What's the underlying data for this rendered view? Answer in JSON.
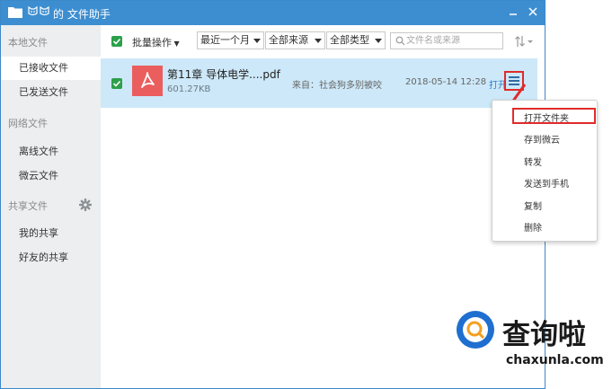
{
  "window": {
    "title": "的 文件助手"
  },
  "sidebar": {
    "section_local": "本地文件",
    "item_received": "已接收文件",
    "item_sent": "已发送文件",
    "section_network": "网络文件",
    "item_offline": "离线文件",
    "item_weiyun": "微云文件",
    "section_shared": "共享文件",
    "item_my_shares": "我的共享",
    "item_friend_shares": "好友的共享"
  },
  "toolbar": {
    "batch_label": "批量操作",
    "filter_time": "最近一个月",
    "filter_source": "全部来源",
    "filter_type": "全部类型",
    "search_placeholder": "文件名或来源"
  },
  "file": {
    "name": "第11章 导体电学....pdf",
    "size": "601.27KB",
    "from": "来自：社会狗多别被咬",
    "date": "2018-05-14 12:28",
    "open_label": "打开"
  },
  "context_menu": {
    "items": [
      "打开文件夹",
      "存到微云",
      "转发",
      "发送到手机",
      "复制",
      "删除"
    ]
  },
  "watermark": {
    "title": "查询啦",
    "domain": "chaxunla.com"
  },
  "colors": {
    "titlebar": "#3d8ed1",
    "selected_row": "#cde8f8",
    "checkbox": "#2ca04a",
    "pdf_icon": "#ea5e5e",
    "highlight": "#e02b2b",
    "link": "#2b7cd3"
  }
}
